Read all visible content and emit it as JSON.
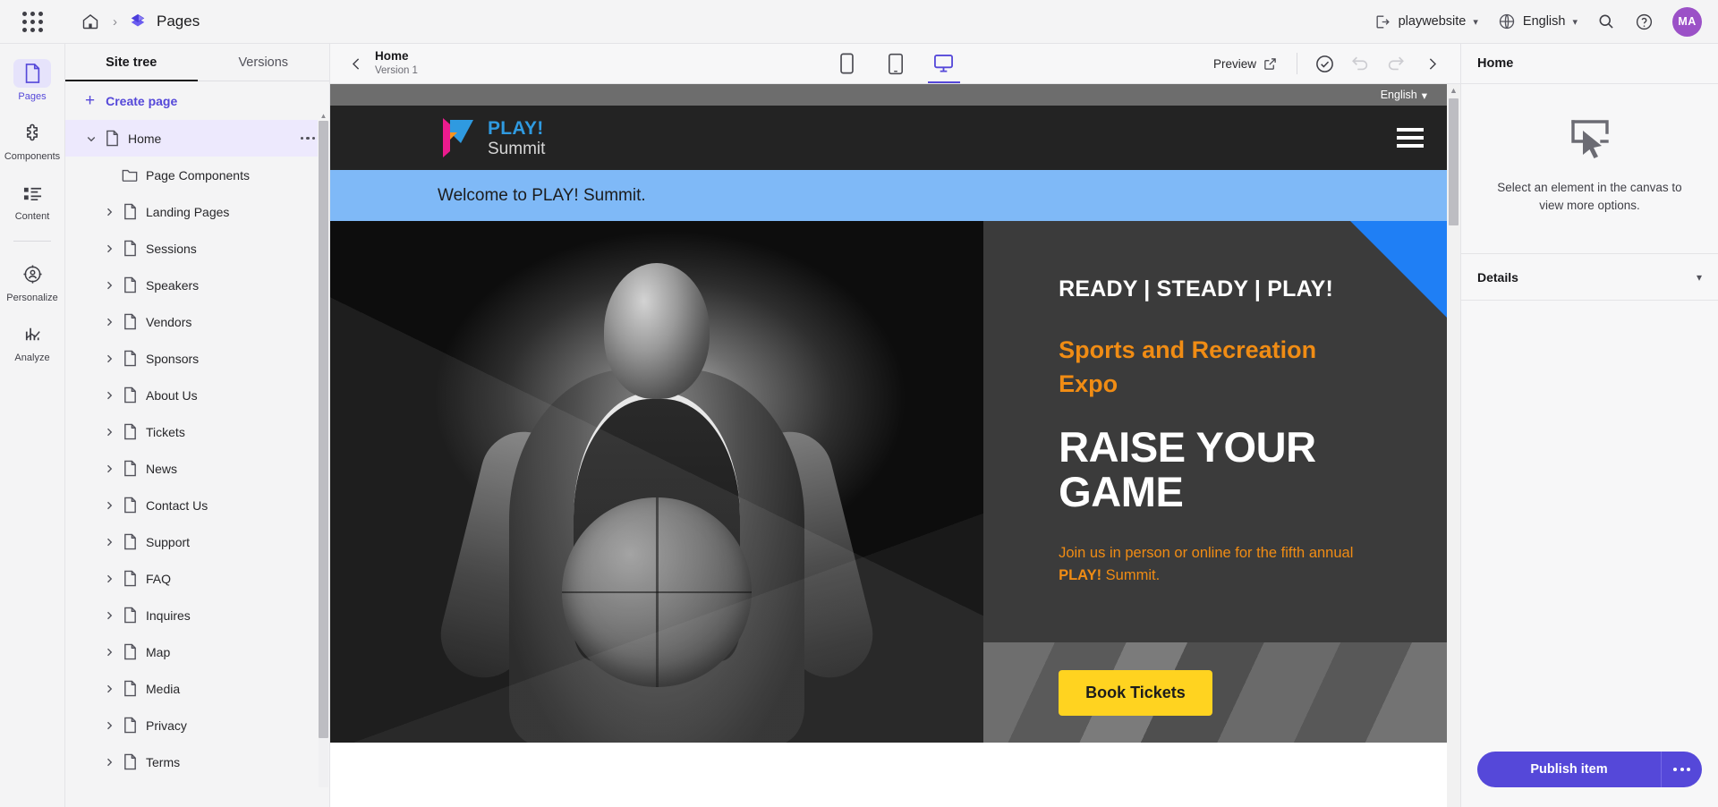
{
  "header": {
    "app_name": "Pages",
    "site_selector": "playwebsite",
    "language_selector": "English",
    "avatar_initials": "MA",
    "icons": {
      "waffle": "app-grid-icon",
      "home": "home-icon",
      "breadcrumb_separator": "chevron-right-icon",
      "app_logo": "pages-layers-icon",
      "site_icon": "site-export-icon",
      "globe": "globe-icon",
      "search": "search-icon",
      "help": "help-circle-icon"
    }
  },
  "rail": {
    "items": [
      {
        "label": "Pages",
        "icon": "page-icon",
        "active": true
      },
      {
        "label": "Components",
        "icon": "puzzle-icon",
        "active": false
      },
      {
        "label": "Content",
        "icon": "content-list-icon",
        "active": false
      },
      {
        "label": "Personalize",
        "icon": "personalize-target-icon",
        "active": false
      },
      {
        "label": "Analyze",
        "icon": "analyze-chart-icon",
        "active": false
      }
    ]
  },
  "sidebar": {
    "tabs": [
      {
        "label": "Site tree",
        "active": true
      },
      {
        "label": "Versions",
        "active": false
      }
    ],
    "create_page_label": "Create page",
    "tree": [
      {
        "label": "Home",
        "icon": "page-file-icon",
        "twisty": "chevron-down",
        "selected": true,
        "indent": 0,
        "more": true
      },
      {
        "label": "Page Components",
        "icon": "folder-icon",
        "twisty": "none",
        "selected": false,
        "indent": 1,
        "more": false
      },
      {
        "label": "Landing Pages",
        "icon": "page-file-icon",
        "twisty": "chevron-right",
        "selected": false,
        "indent": 1,
        "more": false
      },
      {
        "label": "Sessions",
        "icon": "page-file-icon",
        "twisty": "chevron-right",
        "selected": false,
        "indent": 1,
        "more": false
      },
      {
        "label": "Speakers",
        "icon": "page-file-icon",
        "twisty": "chevron-right",
        "selected": false,
        "indent": 1,
        "more": false
      },
      {
        "label": "Vendors",
        "icon": "page-file-icon",
        "twisty": "chevron-right",
        "selected": false,
        "indent": 1,
        "more": false
      },
      {
        "label": "Sponsors",
        "icon": "page-file-icon",
        "twisty": "chevron-right",
        "selected": false,
        "indent": 1,
        "more": false
      },
      {
        "label": "About Us",
        "icon": "page-file-icon",
        "twisty": "chevron-right",
        "selected": false,
        "indent": 1,
        "more": false
      },
      {
        "label": "Tickets",
        "icon": "page-file-icon",
        "twisty": "chevron-right",
        "selected": false,
        "indent": 1,
        "more": false
      },
      {
        "label": "News",
        "icon": "page-file-icon",
        "twisty": "chevron-right",
        "selected": false,
        "indent": 1,
        "more": false
      },
      {
        "label": "Contact Us",
        "icon": "page-file-icon",
        "twisty": "chevron-right",
        "selected": false,
        "indent": 1,
        "more": false
      },
      {
        "label": "Support",
        "icon": "page-file-icon",
        "twisty": "chevron-right",
        "selected": false,
        "indent": 1,
        "more": false
      },
      {
        "label": "FAQ",
        "icon": "page-file-icon",
        "twisty": "chevron-right",
        "selected": false,
        "indent": 1,
        "more": false
      },
      {
        "label": "Inquires",
        "icon": "page-file-icon",
        "twisty": "chevron-right",
        "selected": false,
        "indent": 1,
        "more": false
      },
      {
        "label": "Map",
        "icon": "page-file-icon",
        "twisty": "chevron-right",
        "selected": false,
        "indent": 1,
        "more": false
      },
      {
        "label": "Media",
        "icon": "page-file-icon",
        "twisty": "chevron-right",
        "selected": false,
        "indent": 1,
        "more": false
      },
      {
        "label": "Privacy",
        "icon": "page-file-icon",
        "twisty": "chevron-right",
        "selected": false,
        "indent": 1,
        "more": false
      },
      {
        "label": "Terms",
        "icon": "page-file-icon",
        "twisty": "chevron-right",
        "selected": false,
        "indent": 1,
        "more": false
      }
    ]
  },
  "canvas_toolbar": {
    "page_title": "Home",
    "page_version": "Version 1",
    "devices": [
      {
        "name": "mobile",
        "active": false
      },
      {
        "name": "tablet",
        "active": false
      },
      {
        "name": "desktop",
        "active": true
      }
    ],
    "preview_label": "Preview",
    "actions": [
      {
        "name": "validation-check",
        "disabled": false
      },
      {
        "name": "undo",
        "disabled": true
      },
      {
        "name": "redo",
        "disabled": true
      },
      {
        "name": "next-panel",
        "disabled": false
      }
    ]
  },
  "website": {
    "language_switcher": "English",
    "logo": {
      "primary": "PLAY!",
      "secondary": "Summit"
    },
    "welcome_text": "Welcome to PLAY! Summit.",
    "hero": {
      "kicker": "READY | STEADY | PLAY!",
      "subtitle": "Sports and Recreation Expo",
      "headline": "RAISE YOUR GAME",
      "body_prefix": "Join us in person or online for the fifth annual ",
      "body_bold": "PLAY!",
      "body_suffix": " Summit.",
      "cta_label": "Book Tickets"
    },
    "colors": {
      "nav_background": "#232323",
      "welcome_band": "#7fb9f7",
      "accent_orange": "#f08c14",
      "accent_blue": "#1f7ff5",
      "cta_yellow": "#ffd320"
    }
  },
  "right_panel": {
    "title": "Home",
    "empty_message": "Select an element in the canvas to view more options.",
    "empty_icon": "cursor-select-icon",
    "details_label": "Details",
    "publish_label": "Publish item"
  }
}
